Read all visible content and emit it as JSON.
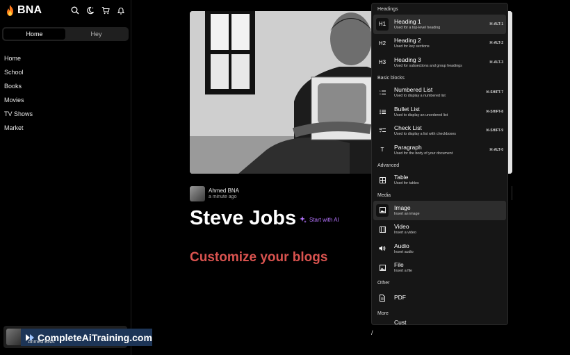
{
  "app": {
    "brand": "BNA"
  },
  "sidebar": {
    "tabs": [
      {
        "label": "Home"
      },
      {
        "label": "Hey"
      }
    ],
    "items": [
      {
        "label": "Home"
      },
      {
        "label": "School"
      },
      {
        "label": "Books"
      },
      {
        "label": "Movies"
      },
      {
        "label": "TV Shows"
      },
      {
        "label": "Market"
      }
    ],
    "profile_name": "Ahmed BNA"
  },
  "watermark": {
    "text": "CompleteAiTraining.com"
  },
  "post": {
    "author": "Ahmed BNA",
    "time": "a minute ago",
    "title": "Steve Jobs",
    "ai_label": "Start with AI",
    "subtitle": "Customize your blogs",
    "cursor": "/"
  },
  "menu": {
    "sections": {
      "headings": "Headings",
      "basic": "Basic blocks",
      "advanced": "Advanced",
      "media": "Media",
      "other": "Other",
      "more": "More"
    },
    "headings": [
      {
        "icon": "H1",
        "title": "Heading 1",
        "sub": "Used for a top-level heading",
        "shortcut": "⌘-ALT-1"
      },
      {
        "icon": "H2",
        "title": "Heading 2",
        "sub": "Used for key sections",
        "shortcut": "⌘-ALT-2"
      },
      {
        "icon": "H3",
        "title": "Heading 3",
        "sub": "Used for subsections and group headings",
        "shortcut": "⌘-ALT-3"
      }
    ],
    "basic": [
      {
        "title": "Numbered List",
        "sub": "Used to display a numbered list",
        "shortcut": "⌘-SHIFT-7"
      },
      {
        "title": "Bullet List",
        "sub": "Used to display an unordered list",
        "shortcut": "⌘-SHIFT-8"
      },
      {
        "title": "Check List",
        "sub": "Used to display a list with checkboxes",
        "shortcut": "⌘-SHIFT-9"
      },
      {
        "icon": "T",
        "title": "Paragraph",
        "sub": "Used for the body of your document",
        "shortcut": "⌘-ALT-0"
      }
    ],
    "advanced": [
      {
        "title": "Table",
        "sub": "Used for tables"
      }
    ],
    "media": [
      {
        "title": "Image",
        "sub": "Insert an image"
      },
      {
        "title": "Video",
        "sub": "Insert a video"
      },
      {
        "title": "Audio",
        "sub": "Insert audio"
      },
      {
        "title": "File",
        "sub": "Insert a file"
      }
    ],
    "other": [
      {
        "title": "PDF"
      }
    ],
    "more_partial": "Cust"
  },
  "colors": {
    "accent_ai": "#b574ff",
    "subtitle": "#d9534f",
    "flame": "#ff7a1a"
  }
}
